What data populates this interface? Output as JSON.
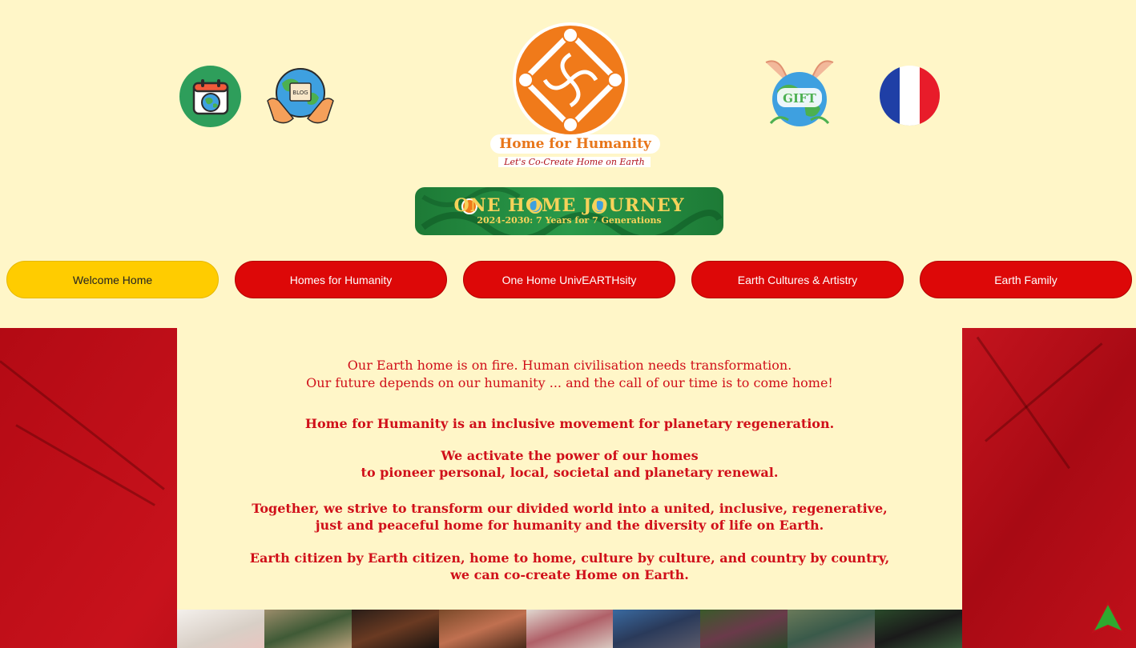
{
  "header": {
    "brand_title": "Home for Humanity",
    "brand_tagline": "Let's Co-Create Home on Earth",
    "icons": [
      "calendar-globe-icon",
      "blog-globe-icon",
      "gift-globe-icon",
      "france-flag-icon"
    ],
    "blog_icon_text": "BLOG",
    "gift_icon_text": "GIFT",
    "banner_title": "ONE HOME JOURNEY",
    "banner_subtitle": "2024-2030: 7 Years for 7 Generations"
  },
  "nav": {
    "items": [
      {
        "label": "Welcome Home"
      },
      {
        "label": "Homes for Humanity"
      },
      {
        "label": "One Home UnivEARTHsity"
      },
      {
        "label": "Earth Cultures & Artistry"
      },
      {
        "label": "Earth Family"
      }
    ]
  },
  "content": {
    "line1": "Our Earth home is on fire. Human civilisation needs transformation.",
    "line2": "Our future depends on our humanity  ... and the call of our time is to come home!",
    "line3": "Home for Humanity is an inclusive movement for planetary regeneration.",
    "line4": "We activate the power of our homes",
    "line5": "to pioneer personal, local, societal and planetary renewal.",
    "line6": "Together, we strive to transform our divided world into a united, inclusive, regenerative,",
    "line7": "just and peaceful home for humanity and the diversity of life on Earth.",
    "line8": "Earth citizen by Earth citizen, home to home, culture by culture, and country by country,",
    "line9": "we can co-create Home on Earth."
  },
  "colors": {
    "background": "#fff6c8",
    "accent_red": "#dd0808",
    "active_yellow": "#ffcc00",
    "text_red": "#d0101a",
    "brand_orange": "#e8761a"
  }
}
